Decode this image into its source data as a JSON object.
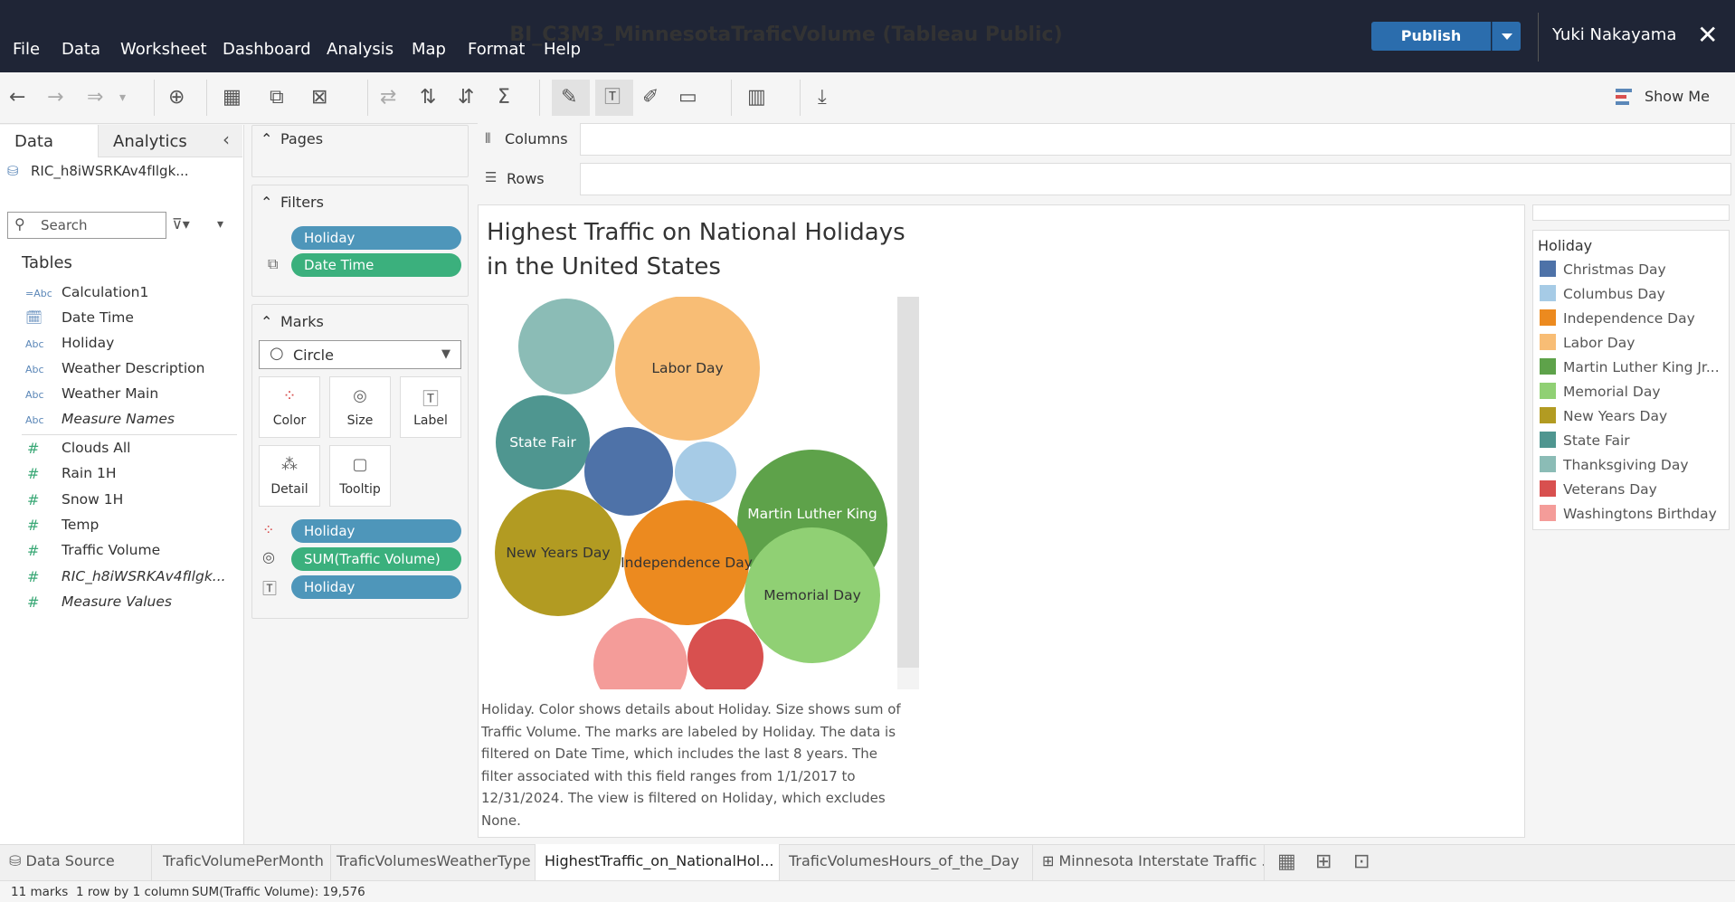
{
  "app": {
    "title": "BI_C3M3_MinnesotaTraficVolume (Tableau Public)",
    "menu": [
      "File",
      "Data",
      "Worksheet",
      "Dashboard",
      "Analysis",
      "Map",
      "Format",
      "Help"
    ],
    "publish_label": "Publish",
    "user": "Yuki Nakayama",
    "show_me_label": "Show Me"
  },
  "data_pane": {
    "tab_data": "Data",
    "tab_analytics": "Analytics",
    "datasource": "RIC_h8iWSRKAv4fIlgk...",
    "search_placeholder": "Search",
    "tables_label": "Tables",
    "dimensions": [
      {
        "icon": "=Abc",
        "name": "Calculation1"
      },
      {
        "icon": "date",
        "name": "Date Time"
      },
      {
        "icon": "Abc",
        "name": "Holiday"
      },
      {
        "icon": "Abc",
        "name": "Weather Description"
      },
      {
        "icon": "Abc",
        "name": "Weather Main"
      },
      {
        "icon": "Abc",
        "name": "Measure Names"
      }
    ],
    "measures": [
      {
        "icon": "#",
        "name": "Clouds All"
      },
      {
        "icon": "#",
        "name": "Rain 1H"
      },
      {
        "icon": "#",
        "name": "Snow 1H"
      },
      {
        "icon": "#",
        "name": "Temp"
      },
      {
        "icon": "#",
        "name": "Traffic Volume"
      },
      {
        "icon": "#",
        "name": "RIC_h8iWSRKAv4fIlgk..."
      },
      {
        "icon": "#",
        "name": "Measure Values"
      }
    ]
  },
  "shelves": {
    "pages_label": "Pages",
    "filters_label": "Filters",
    "filters": [
      "Holiday",
      "Date Time"
    ],
    "marks_label": "Marks",
    "mark_type": "Circle",
    "mark_buttons": [
      "Color",
      "Size",
      "Label",
      "Detail",
      "Tooltip"
    ],
    "mark_pills": [
      "Holiday",
      "SUM(Traffic Volume)",
      "Holiday"
    ],
    "columns_label": "Columns",
    "rows_label": "Rows"
  },
  "view": {
    "title_line1": "Highest Traffic on National Holidays",
    "title_line2": "in the United States",
    "caption": "Holiday.  Color shows details about Holiday.  Size shows sum of Traffic Volume.  The marks are labeled by Holiday. The data is filtered on Date Time, which includes the last 8 years. The filter associated with this field ranges from 1/1/2017 to 12/31/2024. The view is filtered on Holiday, which excludes None."
  },
  "bubbles": [
    {
      "label": "",
      "color": "#8bbcb6",
      "text": "#333"
    },
    {
      "label": "Labor Day",
      "color": "#f8bd75",
      "text": "#333"
    },
    {
      "label": "State Fair",
      "color": "#4f9690",
      "text": "#fff"
    },
    {
      "label": "",
      "color": "#4e72a8",
      "text": "#fff"
    },
    {
      "label": "",
      "color": "#a6cbe6",
      "text": "#333"
    },
    {
      "label": "Martin Luther King Jr Day",
      "color": "#5ea24a",
      "text": "#fff"
    },
    {
      "label": "New Years Day",
      "color": "#b29b22",
      "text": "#333"
    },
    {
      "label": "Independence Day",
      "color": "#ec8a1f",
      "text": "#333"
    },
    {
      "label": "Memorial Day",
      "color": "#90d074",
      "text": "#333"
    },
    {
      "label": "",
      "color": "#f49c99",
      "text": "#333"
    },
    {
      "label": "",
      "color": "#d8504f",
      "text": "#fff"
    }
  ],
  "legend": {
    "title": "Holiday",
    "items": [
      {
        "label": "Christmas Day",
        "color": "#4e72a8"
      },
      {
        "label": "Columbus Day",
        "color": "#a6cbe6"
      },
      {
        "label": "Independence Day",
        "color": "#ec8a1f"
      },
      {
        "label": "Labor Day",
        "color": "#f8bd75"
      },
      {
        "label": "Martin Luther King Jr...",
        "color": "#5ea24a"
      },
      {
        "label": "Memorial Day",
        "color": "#90d074"
      },
      {
        "label": "New Years Day",
        "color": "#b29b22"
      },
      {
        "label": "State Fair",
        "color": "#4f9690"
      },
      {
        "label": "Thanksgiving Day",
        "color": "#8bbcb6"
      },
      {
        "label": "Veterans Day",
        "color": "#d8504f"
      },
      {
        "label": "Washingtons Birthday",
        "color": "#f49c99"
      }
    ]
  },
  "sheet_tabs": {
    "data_source": "Data Source",
    "tabs": [
      "TraficVolumePerMonth",
      "TraficVolumesWeatherType",
      "HighestTraffic_on_NationalHol...",
      "TraficVolumesHours_of_the_Day",
      "Minnesota Interstate Traffic ..."
    ]
  },
  "status": {
    "marks": "11 marks",
    "rows_cols": "1 row by 1 column",
    "sum": "SUM(Traffic Volume): 19,576"
  }
}
